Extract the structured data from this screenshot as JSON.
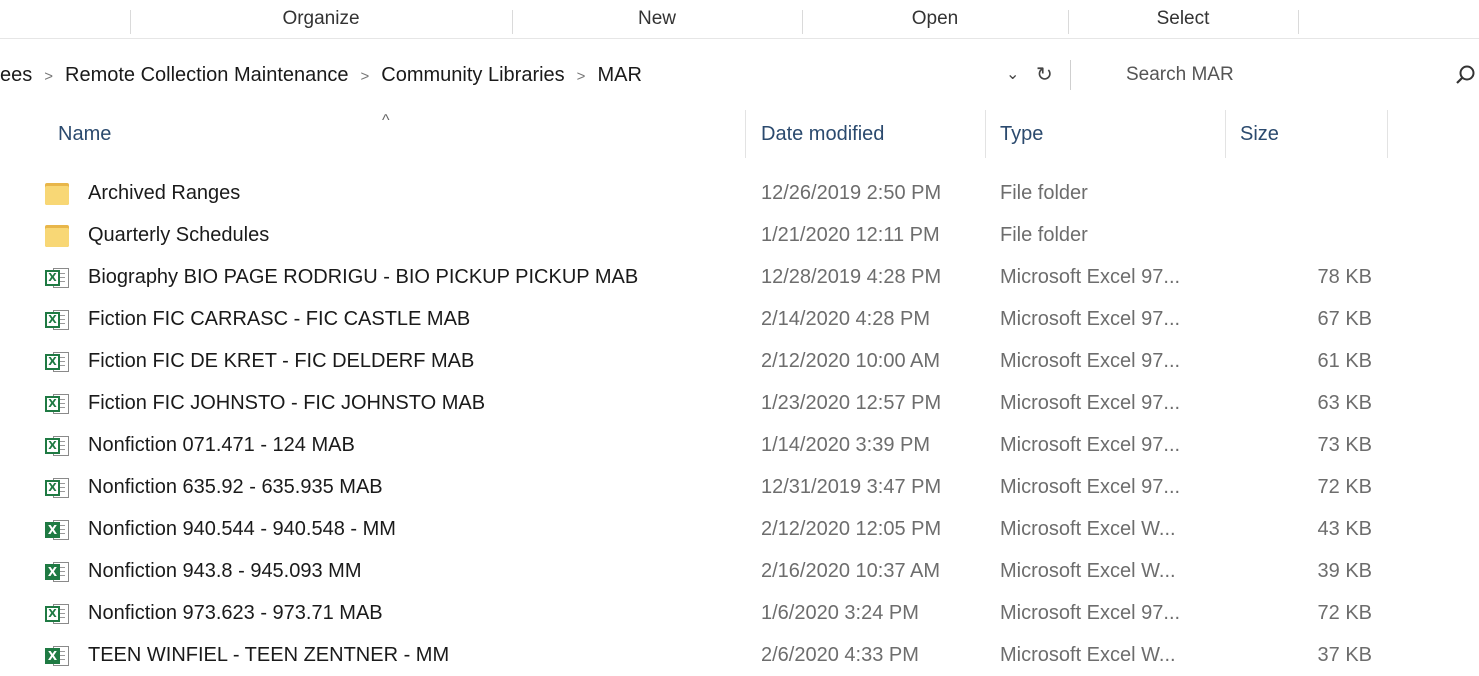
{
  "ribbon": {
    "groups": [
      "Organize",
      "New",
      "Open",
      "Select"
    ]
  },
  "address": {
    "crumbs": [
      "ees",
      "Remote Collection Maintenance",
      "Community Libraries",
      "MAR"
    ],
    "dropdown_glyph": "⌄",
    "refresh_glyph": "↻"
  },
  "search": {
    "placeholder": "Search MAR",
    "icon": "search-icon"
  },
  "columns": {
    "name": "Name",
    "date": "Date modified",
    "type": "Type",
    "size": "Size",
    "sort_glyph": "^"
  },
  "files": [
    {
      "name": "Archived Ranges",
      "date": "12/26/2019 2:50 PM",
      "type": "File folder",
      "size": "",
      "icon": "folder-icon"
    },
    {
      "name": "Quarterly Schedules",
      "date": "1/21/2020 12:11 PM",
      "type": "File folder",
      "size": "",
      "icon": "folder-icon"
    },
    {
      "name": "Biography BIO PAGE RODRIGU - BIO PICKUP PICKUP MAB",
      "date": "12/28/2019 4:28 PM",
      "type": "Microsoft Excel 97...",
      "size": "78 KB",
      "icon": "excel-97-icon"
    },
    {
      "name": "Fiction FIC CARRASC - FIC CASTLE MAB",
      "date": "2/14/2020 4:28 PM",
      "type": "Microsoft Excel 97...",
      "size": "67 KB",
      "icon": "excel-97-icon"
    },
    {
      "name": "Fiction FIC DE KRET - FIC DELDERF MAB",
      "date": "2/12/2020 10:00 AM",
      "type": "Microsoft Excel 97...",
      "size": "61 KB",
      "icon": "excel-97-icon"
    },
    {
      "name": "Fiction FIC JOHNSTO - FIC JOHNSTO MAB",
      "date": "1/23/2020 12:57 PM",
      "type": "Microsoft Excel 97...",
      "size": "63 KB",
      "icon": "excel-97-icon"
    },
    {
      "name": "Nonfiction 071.471 - 124 MAB",
      "date": "1/14/2020 3:39 PM",
      "type": "Microsoft Excel 97...",
      "size": "73 KB",
      "icon": "excel-97-icon"
    },
    {
      "name": "Nonfiction 635.92 - 635.935 MAB",
      "date": "12/31/2019 3:47 PM",
      "type": "Microsoft Excel 97...",
      "size": "72 KB",
      "icon": "excel-97-icon"
    },
    {
      "name": "Nonfiction 940.544  - 940.548 - MM",
      "date": "2/12/2020 12:05 PM",
      "type": "Microsoft Excel W...",
      "size": "43 KB",
      "icon": "excel-workbook-icon"
    },
    {
      "name": "Nonfiction 943.8 - 945.093 MM",
      "date": "2/16/2020 10:37 AM",
      "type": "Microsoft Excel W...",
      "size": "39 KB",
      "icon": "excel-workbook-icon"
    },
    {
      "name": "Nonfiction 973.623 - 973.71 MAB",
      "date": "1/6/2020 3:24 PM",
      "type": "Microsoft Excel 97...",
      "size": "72 KB",
      "icon": "excel-97-icon"
    },
    {
      "name": "TEEN WINFIEL - TEEN ZENTNER - MM",
      "date": "2/6/2020 4:33 PM",
      "type": "Microsoft Excel W...",
      "size": "37 KB",
      "icon": "excel-workbook-icon"
    }
  ]
}
